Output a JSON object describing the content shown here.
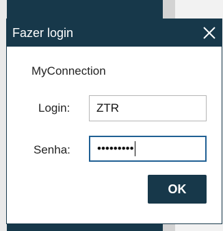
{
  "window": {
    "title": "Fazer login",
    "close_icon": "close-icon"
  },
  "app": {
    "name": "MyConnection"
  },
  "form": {
    "login_label": "Login:",
    "login_value": "ZTR",
    "senha_label": "Senha:",
    "senha_value": "•••••••••"
  },
  "actions": {
    "ok_label": "OK"
  },
  "colors": {
    "titlebar": "#17384a",
    "focus_border": "#1f5f93",
    "button": "#17384a"
  }
}
